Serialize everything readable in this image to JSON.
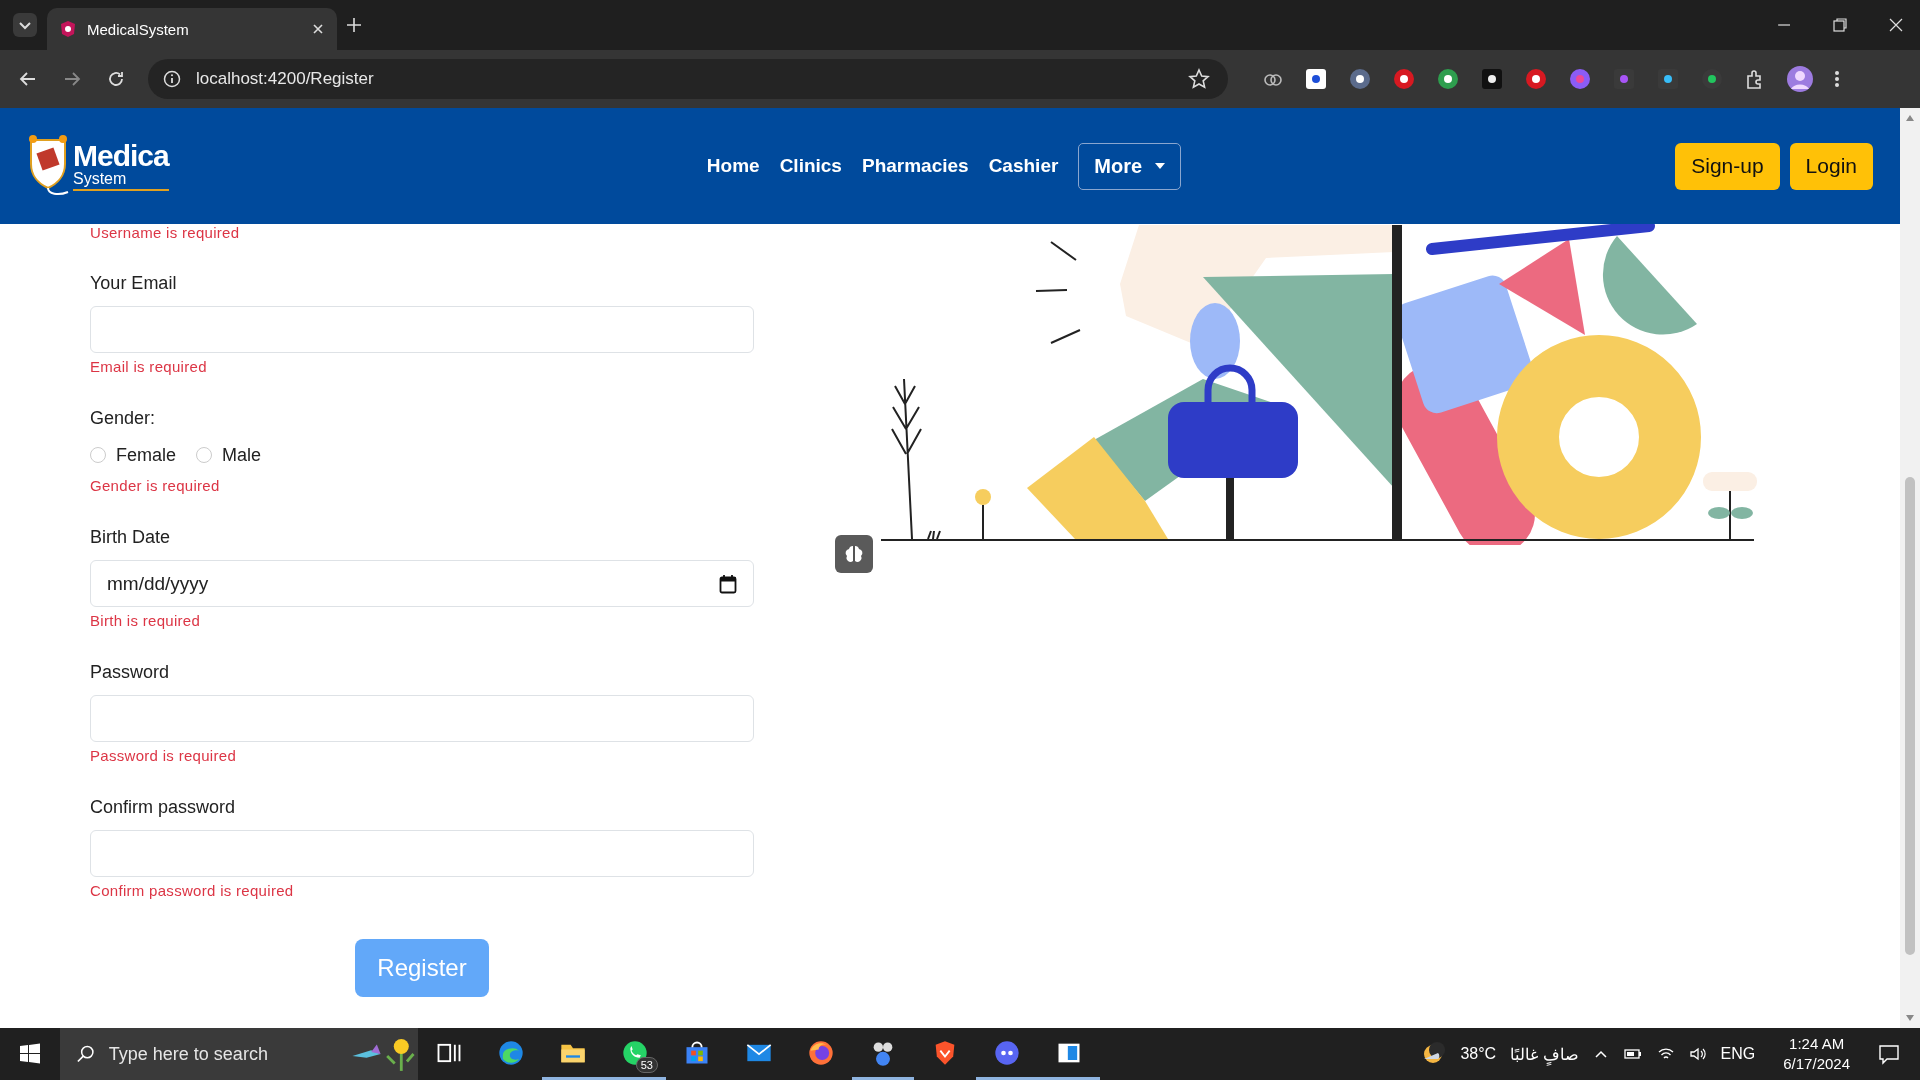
{
  "browser": {
    "tabs": [
      {
        "title": "MedicalSystem",
        "selected": true
      }
    ],
    "address": "localhost:4200/Register"
  },
  "header": {
    "logo": {
      "line_1": "Medica",
      "line_2": "System"
    },
    "nav": [
      "Home",
      "Clinics",
      "Pharmacies",
      "Cashier"
    ],
    "dropdown": "More",
    "buttons": [
      "Sign-up",
      "Login"
    ]
  },
  "form": {
    "top_error": "Username is required",
    "fields": [
      {
        "kind": "text",
        "label": "Your Email",
        "error": "Email is required"
      },
      {
        "kind": "radio",
        "label": "Gender:",
        "options": [
          {
            "label": "Female",
            "selected": false
          },
          {
            "label": "Male",
            "selected": false
          }
        ],
        "error": "Gender is required"
      },
      {
        "kind": "date",
        "label": "Birth Date",
        "placeholder": "mm/dd/yyyy",
        "error": "Birth is required"
      },
      {
        "kind": "password",
        "label": "Password",
        "error": "Password is required"
      },
      {
        "kind": "password",
        "label": "Confirm password",
        "error": "Confirm password is required"
      }
    ],
    "submit": "Register"
  },
  "taskbar": {
    "search_placeholder": "Type here to search",
    "apps": [
      {
        "kind": "taskview",
        "open": false
      },
      {
        "kind": "edge",
        "open": false
      },
      {
        "kind": "folder",
        "open": true
      },
      {
        "kind": "whatsapp",
        "open": true,
        "badge": "53"
      },
      {
        "kind": "store",
        "open": false
      },
      {
        "kind": "mail",
        "open": false
      },
      {
        "kind": "firefox",
        "open": false
      },
      {
        "kind": "people",
        "open": true
      },
      {
        "kind": "brave",
        "open": false
      },
      {
        "kind": "chat",
        "open": true
      },
      {
        "kind": "window",
        "open": true
      }
    ],
    "weather": {
      "temperature": "38°C",
      "condition": "صافٍ غالبًا"
    },
    "language": "ENG",
    "time": "1:24 AM",
    "date": "6/17/2024"
  }
}
